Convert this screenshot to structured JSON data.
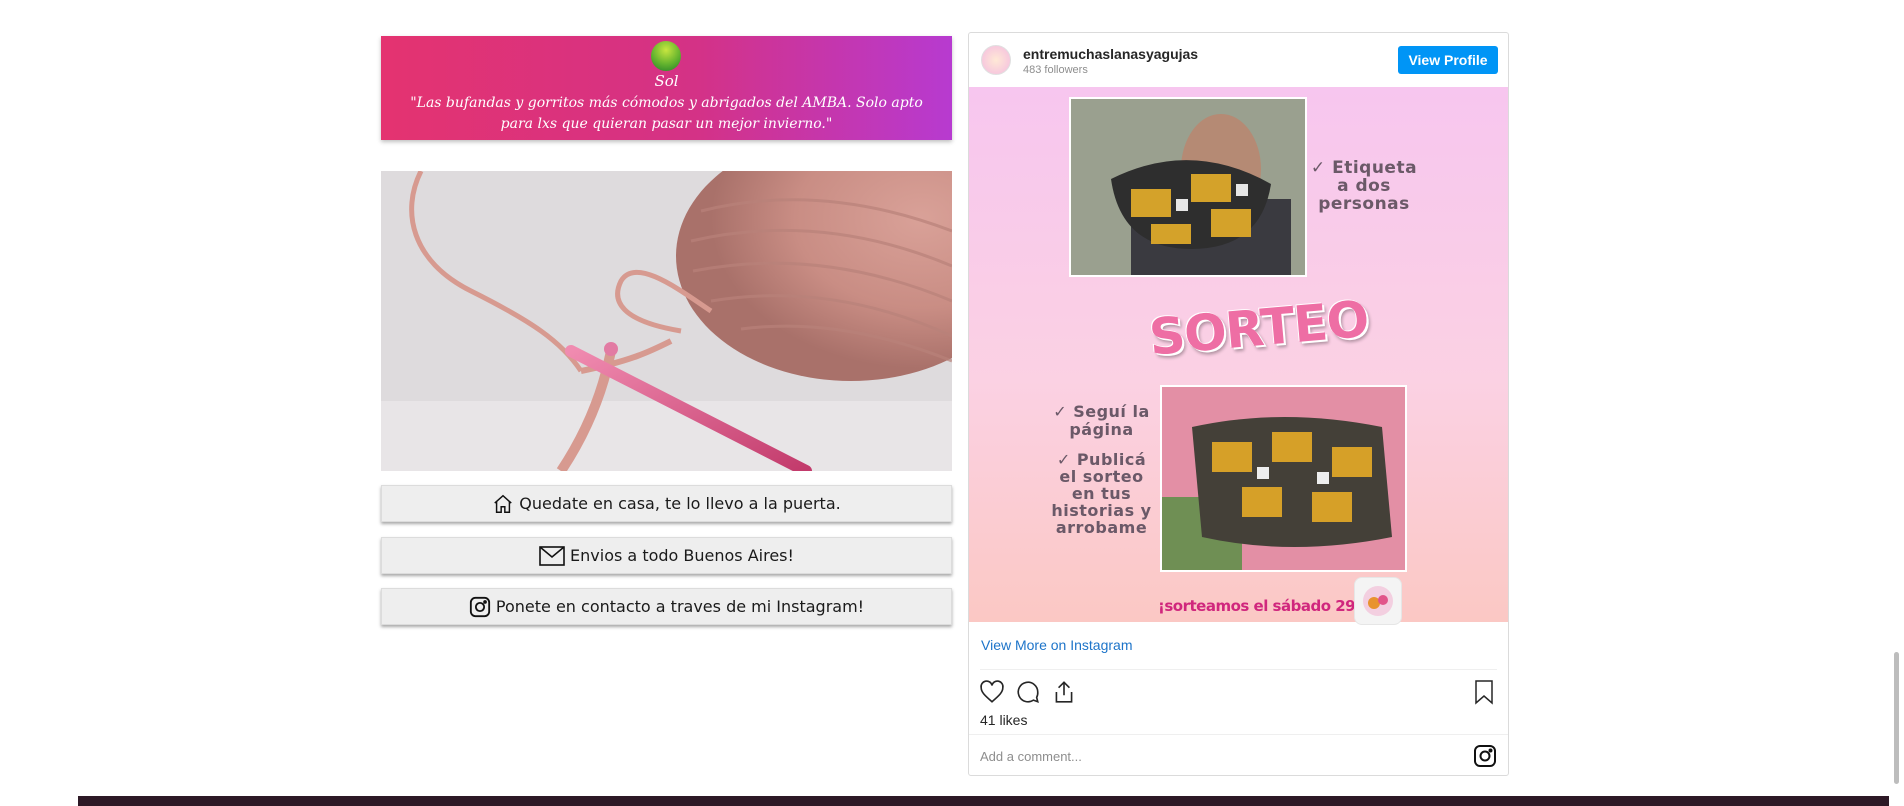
{
  "banner": {
    "name": "Sol",
    "quote": "\"Las bufandas y gorritos más cómodos y abrigados del AMBA. Solo apto para lxs que quieran pasar un mejor invierno.\""
  },
  "actions": [
    {
      "label": "Quedate en casa, te lo llevo a la puerta.",
      "icon": "house-icon"
    },
    {
      "label": "Envios a todo Buenos Aires!",
      "icon": "envelope-icon"
    },
    {
      "label": "Ponete en contacto a traves de mi Instagram!",
      "icon": "instagram-icon"
    }
  ],
  "instagram": {
    "username": "entremuchaslanasyagujas",
    "followers": "483 followers",
    "view_profile": "View Profile",
    "post": {
      "text_top": "✓ Etiqueta a dos personas",
      "title": "SORTEO",
      "text_follow": "✓ Seguí la página",
      "text_publish": "✓ Publicá el sorteo en tus historias y arrobame",
      "date": "¡sorteamos el sábado 29/05!"
    },
    "view_more": "View More on Instagram",
    "likes": "41 likes",
    "comment_placeholder": "Add a comment...",
    "colors": {
      "button": "#0095f6",
      "link": "#1d74c9"
    }
  },
  "colors": {
    "banner_start": "#e43370",
    "banner_end": "#b73ad0",
    "footer": "#2d1926"
  }
}
